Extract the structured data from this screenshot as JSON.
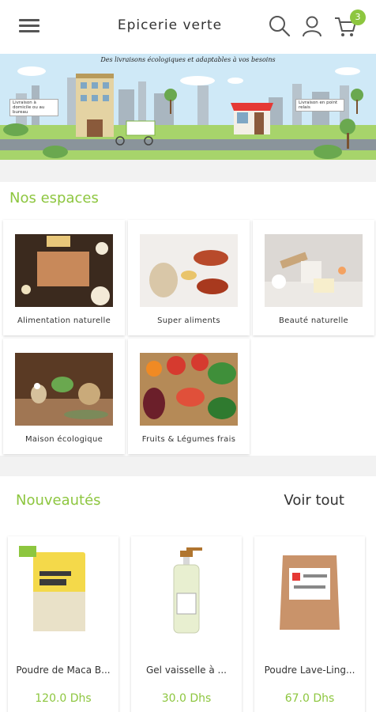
{
  "header": {
    "title": "Epicerie verte",
    "menu_icon": "hamburger-menu-icon",
    "search_icon": "search-icon",
    "user_icon": "user-icon",
    "cart_icon": "cart-icon",
    "cart_count": "3"
  },
  "banner": {
    "headline": "Des livraisons écologiques et adaptables à vos besoins",
    "sign_left": "Livraison à domicile ou au bureau",
    "sign_right": "Livraison en point relais"
  },
  "spaces": {
    "title": "Nos espaces",
    "items": [
      {
        "label": "Alimentation naturelle"
      },
      {
        "label": "Super aliments"
      },
      {
        "label": "Beauté naturelle"
      },
      {
        "label": "Maison écologique"
      },
      {
        "label": "Fruits & Légumes frais"
      }
    ]
  },
  "new_products": {
    "title": "Nouveautés",
    "see_all": "Voir tout",
    "items": [
      {
        "name": "Poudre de Maca B...",
        "price": "120.0 Dhs"
      },
      {
        "name": "Gel vaisselle à ...",
        "price": "30.0 Dhs"
      },
      {
        "name": "Poudre Lave-Ling...",
        "price": "67.0 Dhs"
      }
    ]
  },
  "colors": {
    "accent": "#8dc63f",
    "background": "#f2f2f2"
  }
}
